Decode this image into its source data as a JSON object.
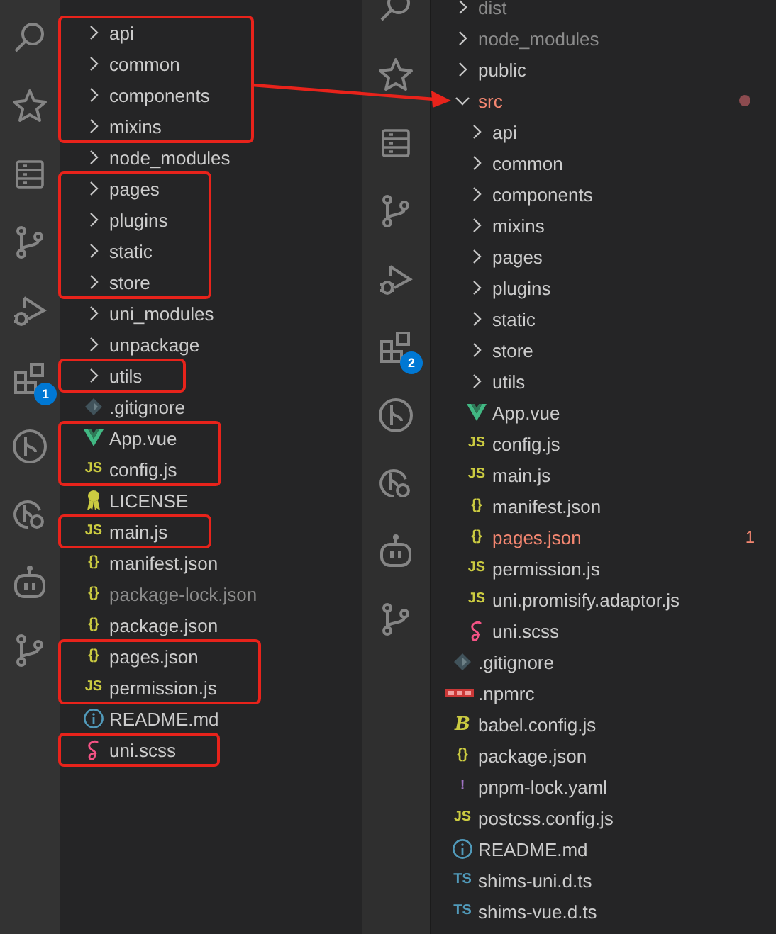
{
  "left": {
    "activity_bar": [
      {
        "kind": "search"
      },
      {
        "kind": "star"
      },
      {
        "kind": "list"
      },
      {
        "kind": "source-control"
      },
      {
        "kind": "run-debug"
      },
      {
        "kind": "extensions",
        "badge": "1"
      },
      {
        "kind": "branch-circle"
      },
      {
        "kind": "remote"
      },
      {
        "kind": "robot"
      },
      {
        "kind": "source-control"
      }
    ],
    "items": [
      {
        "name": "api",
        "kind": "folder",
        "expanded": false,
        "dimmed": false,
        "highlighted": true
      },
      {
        "name": "common",
        "kind": "folder",
        "expanded": false,
        "dimmed": false,
        "highlighted": true
      },
      {
        "name": "components",
        "kind": "folder",
        "expanded": false,
        "dimmed": false,
        "highlighted": true
      },
      {
        "name": "mixins",
        "kind": "folder",
        "expanded": false,
        "dimmed": false,
        "highlighted": true
      },
      {
        "name": "node_modules",
        "kind": "folder",
        "expanded": false,
        "dimmed": false,
        "highlighted": false
      },
      {
        "name": "pages",
        "kind": "folder",
        "expanded": false,
        "dimmed": false,
        "highlighted": true
      },
      {
        "name": "plugins",
        "kind": "folder",
        "expanded": false,
        "dimmed": false,
        "highlighted": true
      },
      {
        "name": "static",
        "kind": "folder",
        "expanded": false,
        "dimmed": false,
        "highlighted": true
      },
      {
        "name": "store",
        "kind": "folder",
        "expanded": false,
        "dimmed": false,
        "highlighted": true
      },
      {
        "name": "uni_modules",
        "kind": "folder",
        "expanded": false,
        "dimmed": false,
        "highlighted": false
      },
      {
        "name": "unpackage",
        "kind": "folder",
        "expanded": false,
        "dimmed": false,
        "highlighted": false
      },
      {
        "name": "utils",
        "kind": "folder",
        "expanded": false,
        "dimmed": false,
        "highlighted": true
      },
      {
        "name": ".gitignore",
        "kind": "gitignore",
        "dimmed": false,
        "highlighted": false
      },
      {
        "name": "App.vue",
        "kind": "vue",
        "dimmed": false,
        "highlighted": true
      },
      {
        "name": "config.js",
        "kind": "js",
        "icon": "JS",
        "dimmed": false,
        "highlighted": true
      },
      {
        "name": "LICENSE",
        "kind": "license",
        "dimmed": false,
        "highlighted": false
      },
      {
        "name": "main.js",
        "kind": "js",
        "icon": "JS",
        "dimmed": false,
        "highlighted": true
      },
      {
        "name": "manifest.json",
        "kind": "json",
        "icon": "{}",
        "dimmed": false,
        "highlighted": false
      },
      {
        "name": "package-lock.json",
        "kind": "json",
        "icon": "{}",
        "dimmed": true,
        "highlighted": false
      },
      {
        "name": "package.json",
        "kind": "json",
        "icon": "{}",
        "dimmed": false,
        "highlighted": false
      },
      {
        "name": "pages.json",
        "kind": "json",
        "icon": "{}",
        "dimmed": false,
        "highlighted": true
      },
      {
        "name": "permission.js",
        "kind": "js",
        "icon": "JS",
        "dimmed": false,
        "highlighted": true
      },
      {
        "name": "README.md",
        "kind": "readme",
        "dimmed": false,
        "highlighted": false
      },
      {
        "name": "uni.scss",
        "kind": "scss",
        "dimmed": false,
        "highlighted": true
      }
    ]
  },
  "right": {
    "activity_bar": [
      {
        "kind": "search"
      },
      {
        "kind": "star"
      },
      {
        "kind": "list"
      },
      {
        "kind": "source-control"
      },
      {
        "kind": "run-debug"
      },
      {
        "kind": "extensions",
        "badge": "2"
      },
      {
        "kind": "branch-circle"
      },
      {
        "kind": "remote"
      },
      {
        "kind": "robot"
      },
      {
        "kind": "source-control"
      }
    ],
    "items": [
      {
        "name": "dist",
        "kind": "folder",
        "expanded": false,
        "dimmed": true,
        "error": false
      },
      {
        "name": "node_modules",
        "kind": "folder",
        "expanded": false,
        "dimmed": true,
        "error": false
      },
      {
        "name": "public",
        "kind": "folder",
        "expanded": false,
        "dimmed": false,
        "error": false
      },
      {
        "name": "src",
        "kind": "folder",
        "expanded": true,
        "dimmed": false,
        "error": true,
        "children": [
          {
            "name": "api",
            "kind": "folder",
            "expanded": false,
            "dimmed": false,
            "error": false
          },
          {
            "name": "common",
            "kind": "folder",
            "expanded": false,
            "dimmed": false,
            "error": false
          },
          {
            "name": "components",
            "kind": "folder",
            "expanded": false,
            "dimmed": false,
            "error": false
          },
          {
            "name": "mixins",
            "kind": "folder",
            "expanded": false,
            "dimmed": false,
            "error": false
          },
          {
            "name": "pages",
            "kind": "folder",
            "expanded": false,
            "dimmed": false,
            "error": false
          },
          {
            "name": "plugins",
            "kind": "folder",
            "expanded": false,
            "dimmed": false,
            "error": false
          },
          {
            "name": "static",
            "kind": "folder",
            "expanded": false,
            "dimmed": false,
            "error": false
          },
          {
            "name": "store",
            "kind": "folder",
            "expanded": false,
            "dimmed": false,
            "error": false
          },
          {
            "name": "utils",
            "kind": "folder",
            "expanded": false,
            "dimmed": false,
            "error": false
          },
          {
            "name": "App.vue",
            "kind": "vue",
            "dimmed": false,
            "error": false
          },
          {
            "name": "config.js",
            "kind": "js",
            "icon": "JS",
            "dimmed": false,
            "error": false
          },
          {
            "name": "main.js",
            "kind": "js",
            "icon": "JS",
            "dimmed": false,
            "error": false
          },
          {
            "name": "manifest.json",
            "kind": "json",
            "icon": "{}",
            "dimmed": false,
            "error": false
          },
          {
            "name": "pages.json",
            "kind": "json",
            "icon": "{}",
            "dimmed": false,
            "error": true,
            "badge": "1"
          },
          {
            "name": "permission.js",
            "kind": "js",
            "icon": "JS",
            "dimmed": false,
            "error": false
          },
          {
            "name": "uni.promisify.adaptor.js",
            "kind": "js",
            "icon": "JS",
            "dimmed": false,
            "error": false
          },
          {
            "name": "uni.scss",
            "kind": "scss",
            "dimmed": false,
            "error": false
          }
        ]
      },
      {
        "name": ".gitignore",
        "kind": "gitignore",
        "dimmed": false,
        "error": false
      },
      {
        "name": ".npmrc",
        "kind": "npmrc",
        "dimmed": false,
        "error": false
      },
      {
        "name": "babel.config.js",
        "kind": "babel",
        "icon": "B",
        "dimmed": false,
        "error": false
      },
      {
        "name": "package.json",
        "kind": "json",
        "icon": "{}",
        "dimmed": false,
        "error": false
      },
      {
        "name": "pnpm-lock.yaml",
        "kind": "yaml",
        "icon": "!",
        "dimmed": false,
        "error": false
      },
      {
        "name": "postcss.config.js",
        "kind": "js",
        "icon": "JS",
        "dimmed": false,
        "error": false
      },
      {
        "name": "README.md",
        "kind": "readme",
        "dimmed": false,
        "error": false
      },
      {
        "name": "shims-uni.d.ts",
        "kind": "ts",
        "icon": "TS",
        "dimmed": false,
        "error": false
      },
      {
        "name": "shims-vue.d.ts",
        "kind": "ts",
        "icon": "TS",
        "dimmed": false,
        "error": false
      }
    ]
  }
}
